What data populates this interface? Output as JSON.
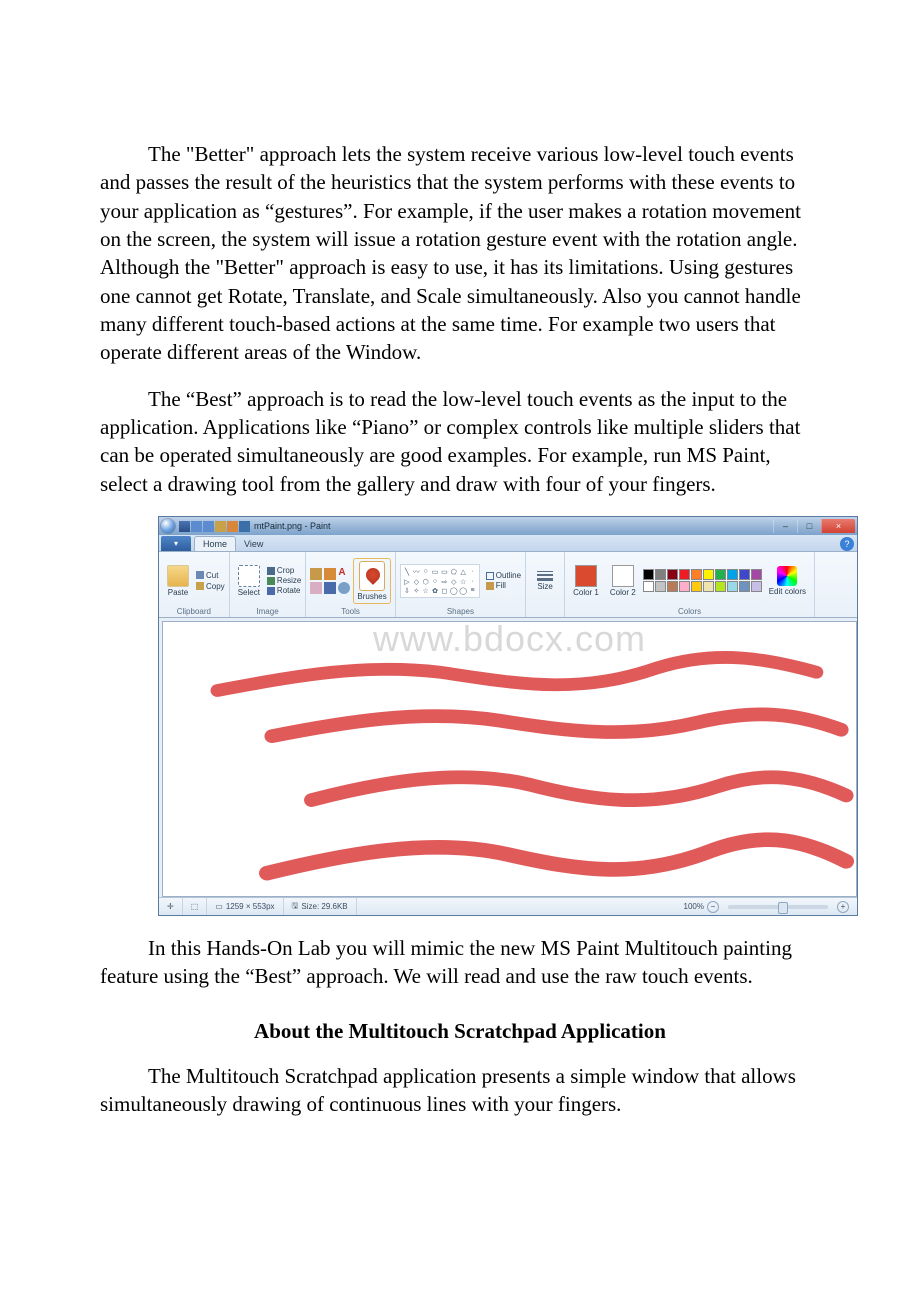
{
  "paragraphs": {
    "p1": "The \"Better\" approach lets the system receive various low-level touch events and passes the result of the heuristics that the system performs with these events to your application as “gestures”. For example, if the user makes a rotation movement on the screen, the system will issue a rotation gesture event with the rotation angle. Although the \"Better\" approach is easy to use, it has its limitations. Using gestures one cannot get Rotate, Translate, and Scale simultaneously. Also you cannot handle many different touch-based actions at the same time. For example two users that operate different areas of the Window.",
    "p2": "The “Best” approach is to read the low-level touch events as the input to the application. Applications like “Piano” or complex controls like multiple sliders that can be operated simultaneously are good examples. For example, run MS Paint, select a drawing tool from the gallery and draw with four of your fingers.",
    "p3": "In this Hands-On Lab you will mimic the new MS Paint Multitouch painting feature using the “Best” approach. We will read and use the raw touch events.",
    "p4": "The Multitouch Scratchpad application presents a simple window that allows simultaneously drawing of continuous lines with your fingers."
  },
  "heading1": "About the Multitouch Scratchpad Application",
  "watermark": "www.bdocx.com",
  "paint": {
    "title": "mtPaint.png - Paint",
    "tabs": {
      "home": "Home",
      "view": "View"
    },
    "help": "?",
    "clipboard": {
      "label": "Clipboard",
      "paste": "Paste",
      "cut": "Cut",
      "copy": "Copy"
    },
    "image": {
      "label": "Image",
      "select": "Select",
      "crop": "Crop",
      "resize": "Resize",
      "rotate": "Rotate"
    },
    "tools": {
      "label": "Tools",
      "brushes": "Brushes"
    },
    "shapes": {
      "label": "Shapes",
      "outline": "Outline",
      "fill": "Fill"
    },
    "size": {
      "label": "Size",
      "btn": "Size"
    },
    "colors": {
      "label": "Colors",
      "color1": "Color 1",
      "color2": "Color 2",
      "edit": "Edit colors",
      "palette": [
        "#000000",
        "#7f7f7f",
        "#880015",
        "#ed1c24",
        "#ff7f27",
        "#fff200",
        "#22b14c",
        "#00a2e8",
        "#3f48cc",
        "#a349a4",
        "#ffffff",
        "#c3c3c3",
        "#b97a57",
        "#ffaec9",
        "#ffc90e",
        "#efe4b0",
        "#b5e61d",
        "#99d9ea",
        "#7092be",
        "#c8bfe7"
      ]
    },
    "status": {
      "dims": "1259 × 553px",
      "size": "Size: 29.6KB",
      "zoom": "100%"
    }
  }
}
